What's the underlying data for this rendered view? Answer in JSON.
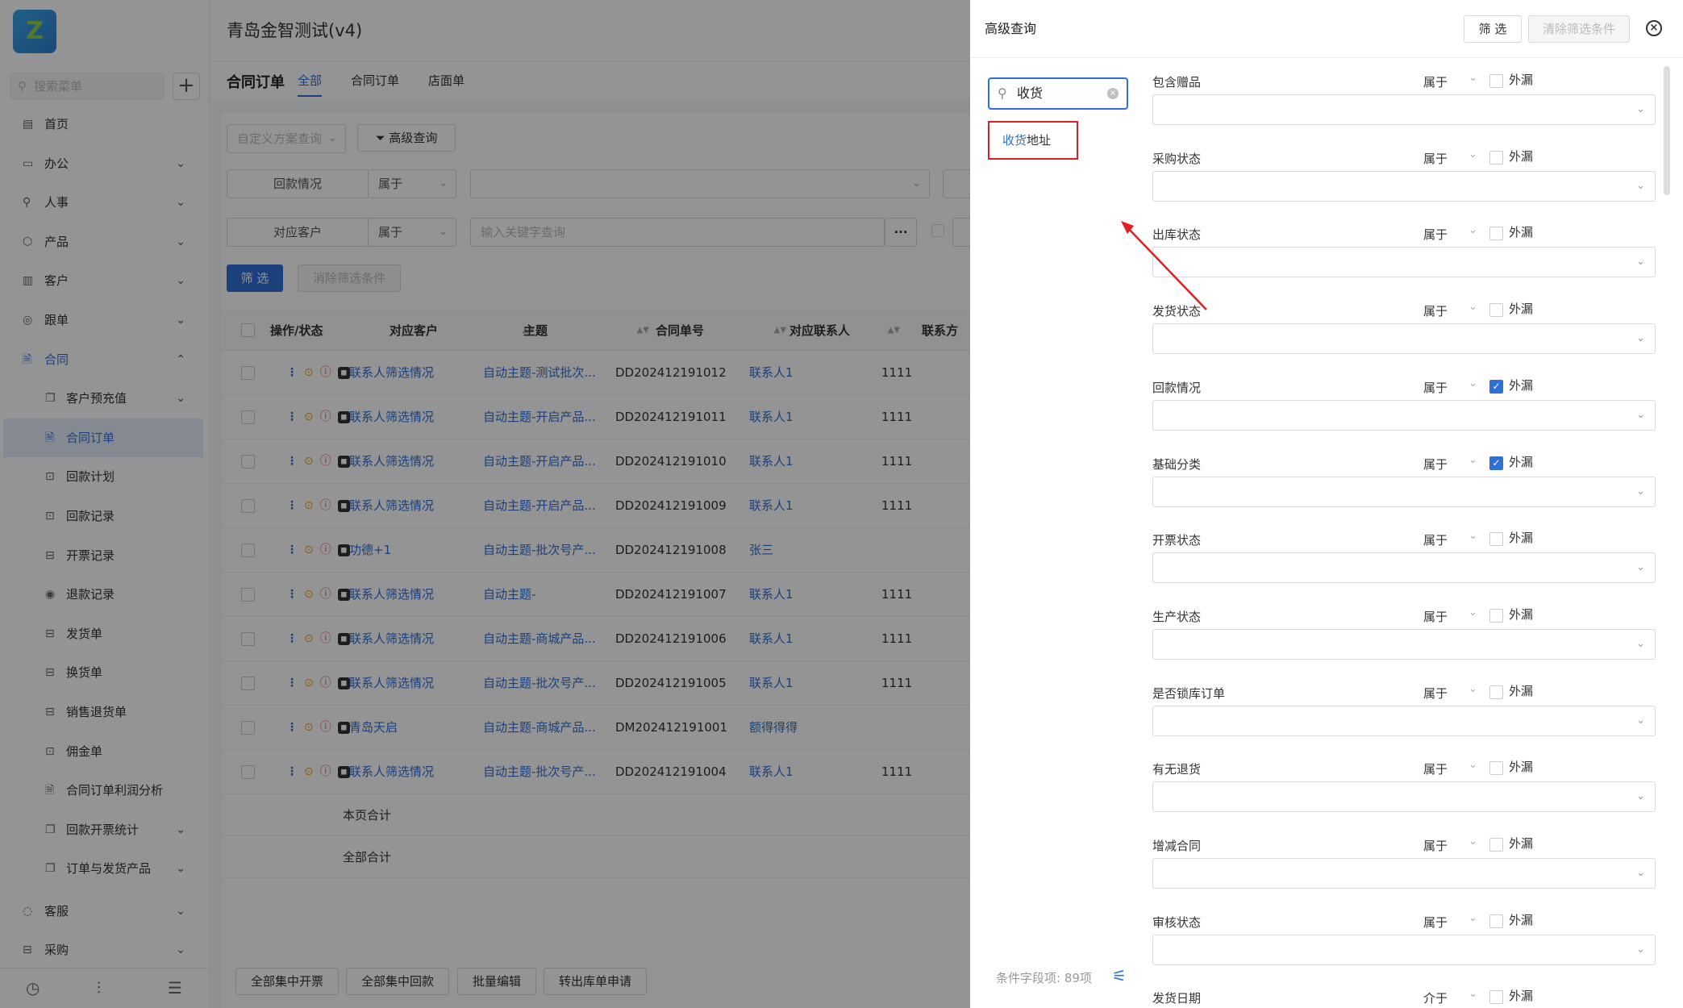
{
  "app": {
    "logo": "Z",
    "title": "青岛金智测试(v4)"
  },
  "sidebar": {
    "search_placeholder": "搜索菜单",
    "items": [
      {
        "label": "首页",
        "icon": "home-icon",
        "glyph": "▤",
        "arrow": ""
      },
      {
        "label": "办公",
        "icon": "office-icon",
        "glyph": "▭",
        "arrow": "⌄"
      },
      {
        "label": "人事",
        "icon": "person-icon",
        "glyph": "⚲",
        "arrow": "⌄"
      },
      {
        "label": "产品",
        "icon": "product-icon",
        "glyph": "⬡",
        "arrow": "⌄"
      },
      {
        "label": "客户",
        "icon": "customer-icon",
        "glyph": "▥",
        "arrow": "⌄"
      },
      {
        "label": "跟单",
        "icon": "follow-icon",
        "glyph": "◎",
        "arrow": "⌄"
      },
      {
        "label": "合同",
        "icon": "contract-icon",
        "glyph": "🗎",
        "arrow": "⌃"
      },
      {
        "label": "客户预充值",
        "icon": "prepay-icon",
        "glyph": "❐",
        "arrow": "⌄"
      },
      {
        "label": "合同订单",
        "icon": "order-icon",
        "glyph": "🗎",
        "arrow": ""
      },
      {
        "label": "回款计划",
        "icon": "plan-icon",
        "glyph": "⊡",
        "arrow": ""
      },
      {
        "label": "回款记录",
        "icon": "record-icon",
        "glyph": "⊡",
        "arrow": ""
      },
      {
        "label": "开票记录",
        "icon": "invoice-icon",
        "glyph": "⊟",
        "arrow": ""
      },
      {
        "label": "退款记录",
        "icon": "refund-icon",
        "glyph": "◉",
        "arrow": ""
      },
      {
        "label": "发货单",
        "icon": "ship-icon",
        "glyph": "⊟",
        "arrow": ""
      },
      {
        "label": "换货单",
        "icon": "exchange-icon",
        "glyph": "⊟",
        "arrow": ""
      },
      {
        "label": "销售退货单",
        "icon": "return-icon",
        "glyph": "⊟",
        "arrow": ""
      },
      {
        "label": "佣金单",
        "icon": "commission-icon",
        "glyph": "⊡",
        "arrow": ""
      },
      {
        "label": "合同订单利润分析",
        "icon": "analysis-icon",
        "glyph": "🗎",
        "arrow": ""
      },
      {
        "label": "回款开票统计",
        "icon": "stats-icon",
        "glyph": "❐",
        "arrow": "⌄"
      },
      {
        "label": "订单与发货产品",
        "icon": "orderprod-icon",
        "glyph": "❐",
        "arrow": "⌄"
      },
      {
        "label": "客服",
        "icon": "service-icon",
        "glyph": "◌",
        "arrow": "⌄"
      },
      {
        "label": "采购",
        "icon": "purchase-icon",
        "glyph": "⊟",
        "arrow": "⌄"
      }
    ]
  },
  "page": {
    "title": "合同订单",
    "tabs": [
      "全部",
      "合同订单",
      "店面单"
    ]
  },
  "toolbar": {
    "scheme": "自定义方案查询",
    "advanced": "高级查询",
    "filter1_field": "回款情况",
    "filter1_op": "属于",
    "filter2_field": "对应客户",
    "filter2_op": "属于",
    "filter2_placeholder": "输入关键字查询",
    "more": "···",
    "filter_btn": "筛 选",
    "clear_btn": "消除筛选条件"
  },
  "table": {
    "headers": [
      "操作/状态",
      "对应客户",
      "主题",
      "合同单号",
      "对应联系人",
      "联系方"
    ],
    "rows": [
      {
        "customer": "联系人筛选情况",
        "subject": "自动主题-测试批次...",
        "no": "DD202412191012",
        "contact": "联系人1",
        "phone": "11111"
      },
      {
        "customer": "联系人筛选情况",
        "subject": "自动主题-开启产品...",
        "no": "DD202412191011",
        "contact": "联系人1",
        "phone": "11111"
      },
      {
        "customer": "联系人筛选情况",
        "subject": "自动主题-开启产品...",
        "no": "DD202412191010",
        "contact": "联系人1",
        "phone": "11111"
      },
      {
        "customer": "联系人筛选情况",
        "subject": "自动主题-开启产品...",
        "no": "DD202412191009",
        "contact": "联系人1",
        "phone": "11111"
      },
      {
        "customer": "功德+1",
        "subject": "自动主题-批次号产...",
        "no": "DD202412191008",
        "contact": "张三",
        "phone": ""
      },
      {
        "customer": "联系人筛选情况",
        "subject": "自动主题-",
        "no": "DD202412191007",
        "contact": "联系人1",
        "phone": "11111"
      },
      {
        "customer": "联系人筛选情况",
        "subject": "自动主题-商城产品...",
        "no": "DD202412191006",
        "contact": "联系人1",
        "phone": "11111"
      },
      {
        "customer": "联系人筛选情况",
        "subject": "自动主题-批次号产...",
        "no": "DD202412191005",
        "contact": "联系人1",
        "phone": "11111"
      },
      {
        "customer": "青岛天启",
        "subject": "自动主题-商城产品...",
        "no": "DM202412191001",
        "contact": "额得得得",
        "phone": ""
      },
      {
        "customer": "联系人筛选情况",
        "subject": "自动主题-批次号产...",
        "no": "DD202412191004",
        "contact": "联系人1",
        "phone": "11111"
      }
    ],
    "page_total": "本页合计",
    "all_total": "全部合计"
  },
  "bottom": [
    "全部集中开票",
    "全部集中回款",
    "批量编辑",
    "转出库单申请"
  ],
  "drawer": {
    "title": "高级查询",
    "filter_btn": "筛 选",
    "clear_btn": "清除筛选条件",
    "search_value": "收货",
    "suggestion_hl": "收货",
    "suggestion_rest": "地址",
    "count_label": "条件字段项: 89项",
    "outside_label": "外漏",
    "conditions": [
      {
        "label": "包含赠品",
        "op": "属于",
        "checked": false
      },
      {
        "label": "采购状态",
        "op": "属于",
        "checked": false
      },
      {
        "label": "出库状态",
        "op": "属于",
        "checked": false
      },
      {
        "label": "发货状态",
        "op": "属于",
        "checked": false
      },
      {
        "label": "回款情况",
        "op": "属于",
        "checked": true
      },
      {
        "label": "基础分类",
        "op": "属于",
        "checked": true
      },
      {
        "label": "开票状态",
        "op": "属于",
        "checked": false
      },
      {
        "label": "生产状态",
        "op": "属于",
        "checked": false
      },
      {
        "label": "是否锁库订单",
        "op": "属于",
        "checked": false
      },
      {
        "label": "有无退货",
        "op": "属于",
        "checked": false
      },
      {
        "label": "增减合同",
        "op": "属于",
        "checked": false
      },
      {
        "label": "审核状态",
        "op": "属于",
        "checked": false
      },
      {
        "label": "发货日期",
        "op": "介于",
        "checked": false
      }
    ]
  },
  "colors": {
    "accent": "#2f6fd6",
    "highlight_border": "#e02020"
  }
}
